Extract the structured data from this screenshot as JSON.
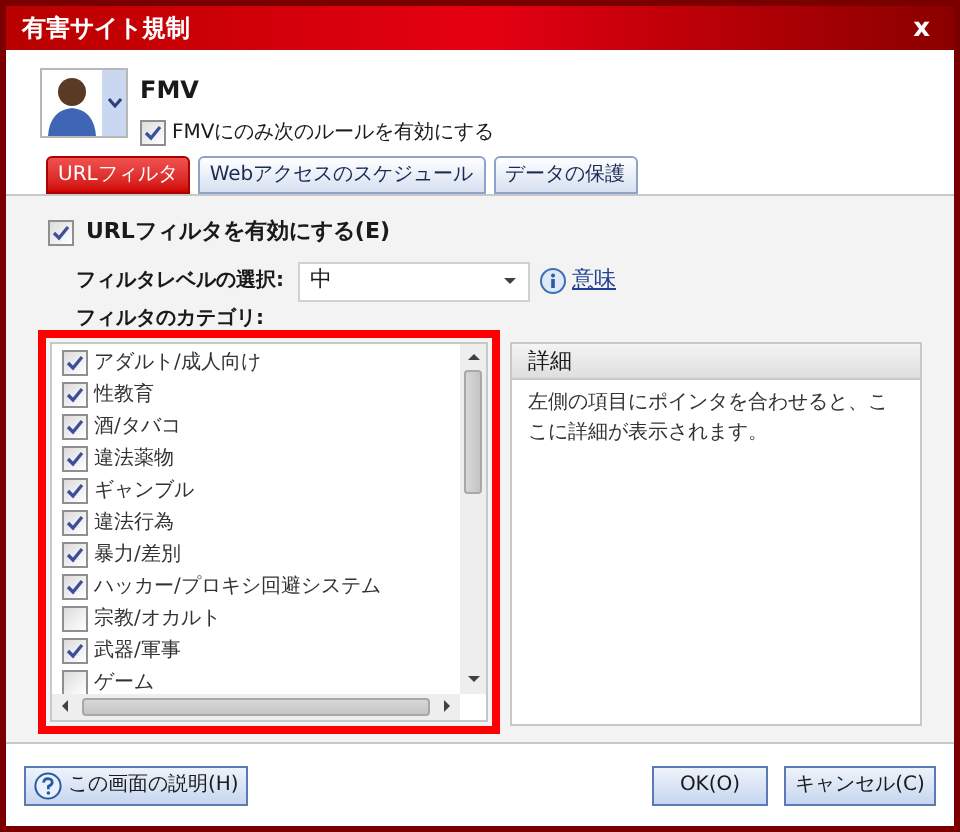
{
  "window": {
    "title": "有害サイト規制",
    "close": "x"
  },
  "user": {
    "name": "FMV",
    "rule_checkbox": {
      "label": "FMVにのみ次のルールを有効にする",
      "checked": true
    }
  },
  "tabs": [
    {
      "label": "URLフィルタ",
      "selected": true
    },
    {
      "label": "Webアクセスのスケジュール",
      "selected": false
    },
    {
      "label": "データの保護",
      "selected": false
    }
  ],
  "url_filter": {
    "label": "URLフィルタを有効にする(E)",
    "checked": true
  },
  "filter_level": {
    "label": "フィルタレベルの選択:",
    "value": "中",
    "link": "意味"
  },
  "categories_label": "フィルタのカテゴリ:",
  "categories": [
    {
      "label": "アダルト/成人向け",
      "checked": true
    },
    {
      "label": "性教育",
      "checked": true
    },
    {
      "label": "酒/タバコ",
      "checked": true
    },
    {
      "label": "違法薬物",
      "checked": true
    },
    {
      "label": "ギャンブル",
      "checked": true
    },
    {
      "label": "違法行為",
      "checked": true
    },
    {
      "label": "暴力/差別",
      "checked": true
    },
    {
      "label": "ハッカー/プロキシ回避システム",
      "checked": true
    },
    {
      "label": "宗教/オカルト",
      "checked": false
    },
    {
      "label": "武器/軍事",
      "checked": true
    },
    {
      "label": "ゲーム",
      "checked": false
    }
  ],
  "details": {
    "title": "詳細",
    "text": "左側の項目にポインタを合わせると、ここに詳細が表示されます。"
  },
  "buttons": {
    "help": "この画面の説明(H)",
    "ok": "OK(O)",
    "cancel": "キャンセル(C)"
  }
}
